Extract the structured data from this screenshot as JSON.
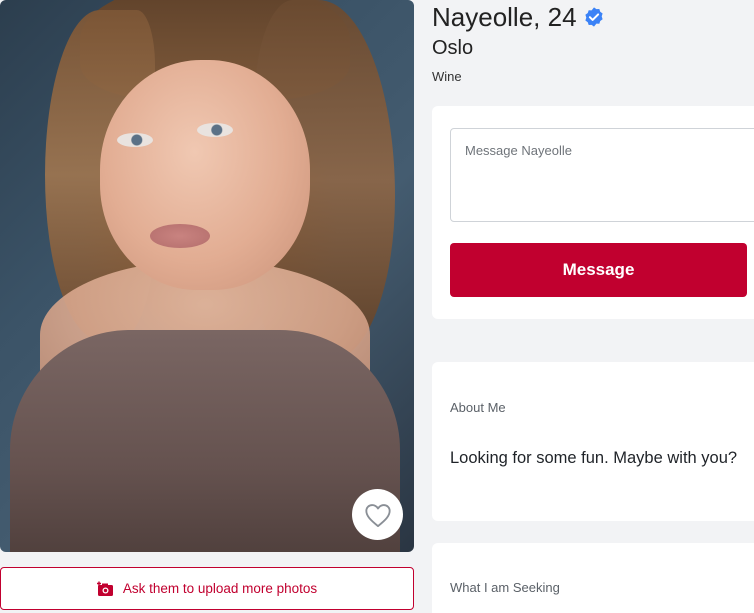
{
  "profile": {
    "name_age": "Nayeolle, 24",
    "city": "Oslo",
    "tag": "Wine",
    "verified": true
  },
  "photo": {
    "favorite_icon": "heart-outline-icon",
    "upload_label": "Ask them to upload more photos",
    "upload_icon": "camera-plus-icon"
  },
  "message": {
    "placeholder": "Message Nayeolle",
    "button_label": "Message"
  },
  "about": {
    "heading": "About Me",
    "text": "Looking for some fun. Maybe with you?"
  },
  "seeking": {
    "heading": "What I am Seeking"
  },
  "colors": {
    "accent": "#c1002f",
    "verified": "#3b82f6",
    "background": "#f2f3f5"
  }
}
